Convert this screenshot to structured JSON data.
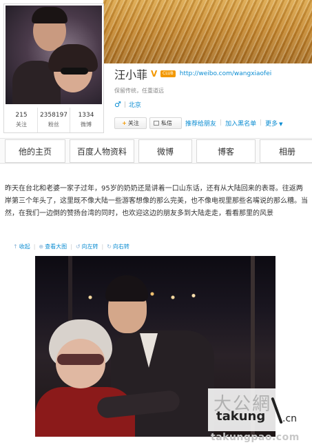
{
  "profile": {
    "name": "汪小菲",
    "verified_icon": "v-verified-icon",
    "club_badge": "CLUB",
    "homepage": "http://weibo.com/wangxiaofei",
    "description": "保留传统，任重道远",
    "gender_icon": "male-icon",
    "location": "北京"
  },
  "stats": [
    {
      "value": "215",
      "label": "关注"
    },
    {
      "value": "2358197",
      "label": "粉丝"
    },
    {
      "value": "1334",
      "label": "微博"
    }
  ],
  "actions": {
    "follow": "关注",
    "message": "私信",
    "recommend": "推荐给朋友",
    "blacklist": "加入黑名单",
    "more": "更多"
  },
  "tabs": [
    "他的主页",
    "百度人物资料",
    "微博",
    "博客",
    "相册"
  ],
  "post": {
    "text": "昨天在台北和老婆一家子过年，95岁的奶奶还是讲着一口山东话，还有从大陆回来的表哥。往返两岸第三个年头了，这里既不像大陆一些游客想像的那么完美，也不像电视里那些名嘴说的那么糟。当然，在我们一边倒的赞扬台湾的同时，也欢迎这边的朋友多到大陆走走，看看那里的风景"
  },
  "toolbar": {
    "collapse": "收起",
    "view_large": "查看大图",
    "rotate_left": "向左转",
    "rotate_right": "向右转"
  },
  "watermark": {
    "brand_cn": "大公網",
    "brand_en": "takung",
    "brand_suffix": ".cn",
    "domain": "takungpao.com"
  }
}
